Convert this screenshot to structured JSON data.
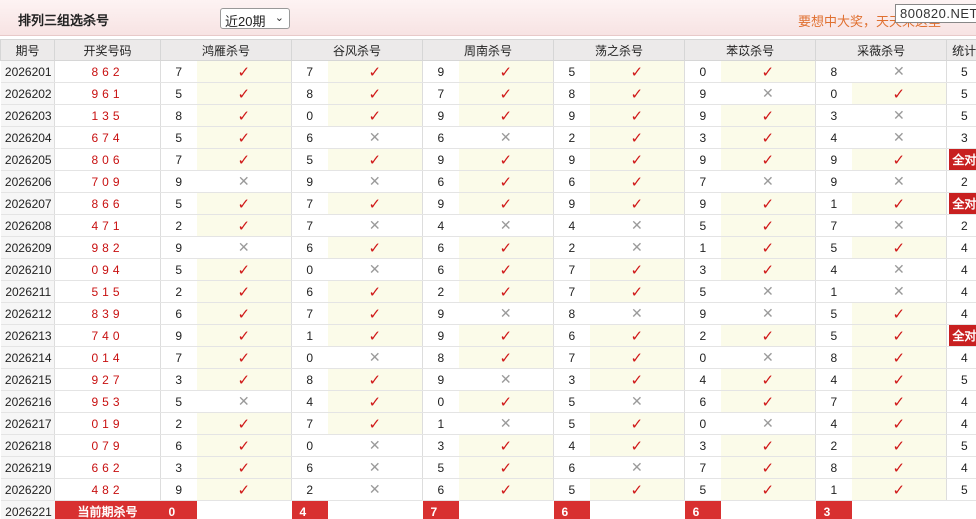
{
  "header": {
    "title": "排列三组选杀号",
    "period_select": "近20期",
    "slogan": "要想中大奖，天天来这里",
    "watermark": "800820.NET"
  },
  "columns": {
    "issue": "期号",
    "number": "开奖号码",
    "experts": [
      "鸿雁杀号",
      "谷风杀号",
      "周南杀号",
      "荡之杀号",
      "苯苡杀号",
      "采薇杀号"
    ],
    "stats": "统计"
  },
  "rows": [
    {
      "issue": "2026201",
      "num": "862",
      "kills": [
        7,
        7,
        9,
        5,
        0,
        8
      ],
      "ok": [
        1,
        1,
        1,
        1,
        1,
        0
      ],
      "stat": "5"
    },
    {
      "issue": "2026202",
      "num": "961",
      "kills": [
        5,
        8,
        7,
        8,
        9,
        0
      ],
      "ok": [
        1,
        1,
        1,
        1,
        0,
        1
      ],
      "stat": "5"
    },
    {
      "issue": "2026203",
      "num": "135",
      "kills": [
        8,
        0,
        9,
        9,
        9,
        3
      ],
      "ok": [
        1,
        1,
        1,
        1,
        1,
        0
      ],
      "stat": "5"
    },
    {
      "issue": "2026204",
      "num": "674",
      "kills": [
        5,
        6,
        6,
        2,
        3,
        4
      ],
      "ok": [
        1,
        0,
        0,
        1,
        1,
        0
      ],
      "stat": "3"
    },
    {
      "issue": "2026205",
      "num": "806",
      "kills": [
        7,
        5,
        9,
        9,
        9,
        9
      ],
      "ok": [
        1,
        1,
        1,
        1,
        1,
        1
      ],
      "stat": "全对"
    },
    {
      "issue": "2026206",
      "num": "709",
      "kills": [
        9,
        9,
        6,
        6,
        7,
        9
      ],
      "ok": [
        0,
        0,
        1,
        1,
        0,
        0
      ],
      "stat": "2"
    },
    {
      "issue": "2026207",
      "num": "866",
      "kills": [
        5,
        7,
        9,
        9,
        9,
        1
      ],
      "ok": [
        1,
        1,
        1,
        1,
        1,
        1
      ],
      "stat": "全对"
    },
    {
      "issue": "2026208",
      "num": "471",
      "kills": [
        2,
        7,
        4,
        4,
        5,
        7
      ],
      "ok": [
        1,
        0,
        0,
        0,
        1,
        0
      ],
      "stat": "2"
    },
    {
      "issue": "2026209",
      "num": "982",
      "kills": [
        9,
        6,
        6,
        2,
        1,
        5
      ],
      "ok": [
        0,
        1,
        1,
        0,
        1,
        1
      ],
      "stat": "4"
    },
    {
      "issue": "2026210",
      "num": "094",
      "kills": [
        5,
        0,
        6,
        7,
        3,
        4
      ],
      "ok": [
        1,
        0,
        1,
        1,
        1,
        0
      ],
      "stat": "4"
    },
    {
      "issue": "2026211",
      "num": "515",
      "kills": [
        2,
        6,
        2,
        7,
        5,
        1
      ],
      "ok": [
        1,
        1,
        1,
        1,
        0,
        0
      ],
      "stat": "4"
    },
    {
      "issue": "2026212",
      "num": "839",
      "kills": [
        6,
        7,
        9,
        8,
        9,
        5
      ],
      "ok": [
        1,
        1,
        0,
        0,
        0,
        1
      ],
      "stat": "4"
    },
    {
      "issue": "2026213",
      "num": "740",
      "kills": [
        9,
        1,
        9,
        6,
        2,
        5
      ],
      "ok": [
        1,
        1,
        1,
        1,
        1,
        1
      ],
      "stat": "全对"
    },
    {
      "issue": "2026214",
      "num": "014",
      "kills": [
        7,
        0,
        8,
        7,
        0,
        8
      ],
      "ok": [
        1,
        0,
        1,
        1,
        0,
        1
      ],
      "stat": "4"
    },
    {
      "issue": "2026215",
      "num": "927",
      "kills": [
        3,
        8,
        9,
        3,
        4,
        4
      ],
      "ok": [
        1,
        1,
        0,
        1,
        1,
        1
      ],
      "stat": "5"
    },
    {
      "issue": "2026216",
      "num": "953",
      "kills": [
        5,
        4,
        0,
        5,
        6,
        7
      ],
      "ok": [
        0,
        1,
        1,
        0,
        1,
        1
      ],
      "stat": "4"
    },
    {
      "issue": "2026217",
      "num": "019",
      "kills": [
        2,
        7,
        1,
        5,
        0,
        4
      ],
      "ok": [
        1,
        1,
        0,
        1,
        0,
        1
      ],
      "stat": "4"
    },
    {
      "issue": "2026218",
      "num": "079",
      "kills": [
        6,
        0,
        3,
        4,
        3,
        2
      ],
      "ok": [
        1,
        0,
        1,
        1,
        1,
        1
      ],
      "stat": "5"
    },
    {
      "issue": "2026219",
      "num": "662",
      "kills": [
        3,
        6,
        5,
        6,
        7,
        8
      ],
      "ok": [
        1,
        0,
        1,
        0,
        1,
        1
      ],
      "stat": "4"
    },
    {
      "issue": "2026220",
      "num": "482",
      "kills": [
        9,
        2,
        6,
        5,
        5,
        1
      ],
      "ok": [
        1,
        0,
        1,
        1,
        1,
        1
      ],
      "stat": "5"
    }
  ],
  "current": {
    "issue": "2026221",
    "label": "当前期杀号",
    "kills": [
      "0",
      "4",
      "7",
      "6",
      "6",
      "3"
    ]
  },
  "colors": {
    "accent_red": "#d83030",
    "check_red": "#d01818",
    "slogan_orange": "#e07030"
  },
  "icons": {
    "ok": "check-icon",
    "fail": "cross-icon"
  }
}
